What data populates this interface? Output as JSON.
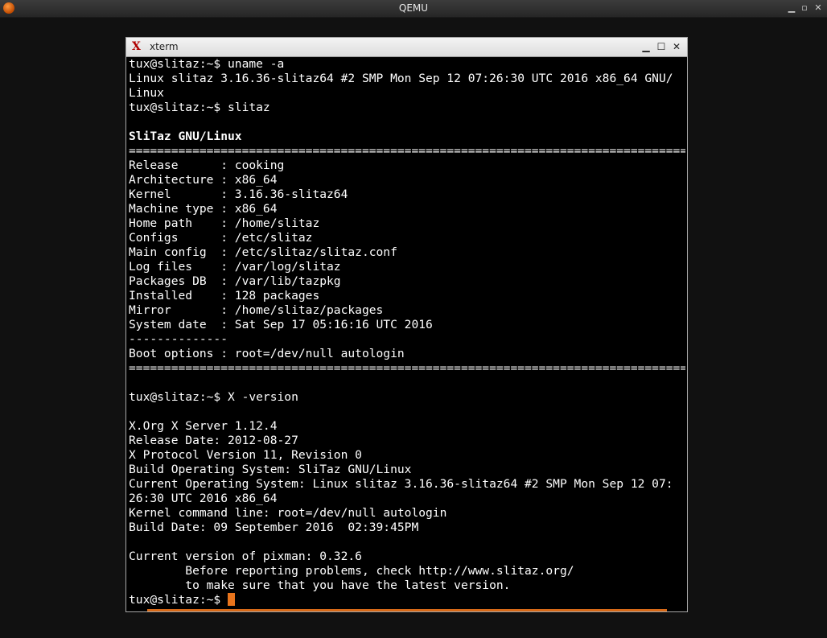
{
  "qemu": {
    "title": "QEMU",
    "minimize": "▁",
    "maximize": "▫",
    "close": "✕"
  },
  "xterm": {
    "title": "xterm",
    "icon_glyph": "X",
    "minimize": "▁",
    "maximize": "☐",
    "close": "✕"
  },
  "terminal": {
    "lines": [
      "tux@slitaz:~$ uname -a",
      "Linux slitaz 3.16.36-slitaz64 #2 SMP Mon Sep 12 07:26:30 UTC 2016 x86_64 GNU/",
      "Linux",
      "tux@slitaz:~$ slitaz",
      "",
      "SliTaz GNU/Linux",
      "================================================================================",
      "Release      : cooking",
      "Architecture : x86_64",
      "Kernel       : 3.16.36-slitaz64",
      "Machine type : x86_64",
      "Home path    : /home/slitaz",
      "Configs      : /etc/slitaz",
      "Main config  : /etc/slitaz/slitaz.conf",
      "Log files    : /var/log/slitaz",
      "Packages DB  : /var/lib/tazpkg",
      "Installed    : 128 packages",
      "Mirror       : /home/slitaz/packages",
      "System date  : Sat Sep 17 05:16:16 UTC 2016",
      "--------------",
      "Boot options : root=/dev/null autologin",
      "================================================================================",
      "",
      "tux@slitaz:~$ X -version",
      "",
      "X.Org X Server 1.12.4",
      "Release Date: 2012-08-27",
      "X Protocol Version 11, Revision 0",
      "Build Operating System: SliTaz GNU/Linux",
      "Current Operating System: Linux slitaz 3.16.36-slitaz64 #2 SMP Mon Sep 12 07:",
      "26:30 UTC 2016 x86_64",
      "Kernel command line: root=/dev/null autologin",
      "Build Date: 09 September 2016  02:39:45PM",
      "",
      "Current version of pixman: 0.32.6",
      "        Before reporting problems, check http://www.slitaz.org/",
      "        to make sure that you have the latest version."
    ],
    "bold_line_index": 5,
    "prompt": "tux@slitaz:~$ ",
    "cursor_color": "#e8741c"
  }
}
